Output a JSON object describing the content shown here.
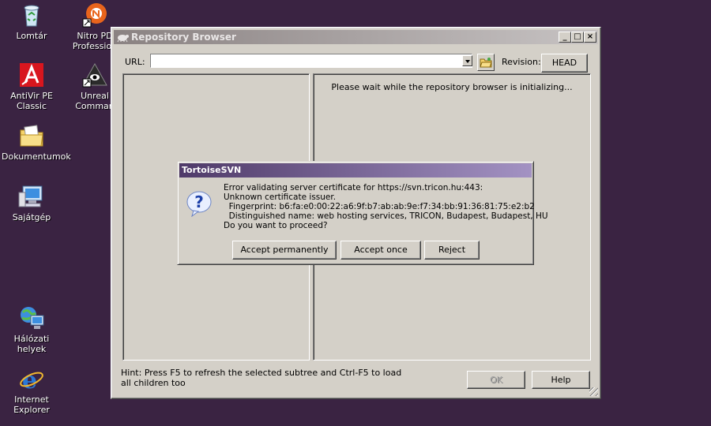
{
  "desktop": {
    "icons": [
      {
        "label": "Lomtár"
      },
      {
        "label": "Nitro PD\nProfession"
      },
      {
        "label": "AntiVir PE\nClassic"
      },
      {
        "label": "Unreal\nComman"
      },
      {
        "label": "Dokumentumok"
      },
      {
        "label": "Sajátgép"
      },
      {
        "label": "Hálózati helyek"
      },
      {
        "label": "Internet\nExplorer"
      }
    ]
  },
  "repo_window": {
    "title": "Repository Browser",
    "url_label": "URL:",
    "url_value": "",
    "revision_label": "Revision:",
    "revision_button": "HEAD",
    "status_message": "Please wait while the repository browser is initializing...",
    "hint": "Hint: Press F5 to refresh the selected subtree and Ctrl-F5 to load all children too",
    "ok_button": "OK",
    "help_button": "Help",
    "controls": {
      "minimize": "_",
      "maximize": "□",
      "close": "×"
    }
  },
  "dialog": {
    "title": "TortoiseSVN",
    "message": "Error validating server certificate for https://svn.tricon.hu:443:\nUnknown certificate issuer.\n  Fingerprint: b6:fa:e0:00:22:a6:9f:b7:ab:ab:9e:f7:34:bb:91:36:81:75:e2:b2\n  Distinguished name: web hosting services, TRICON, Budapest, Budapest, HU\nDo you want to proceed?",
    "buttons": {
      "accept_permanently": "Accept permanently",
      "accept_once": "Accept once",
      "reject": "Reject"
    }
  }
}
